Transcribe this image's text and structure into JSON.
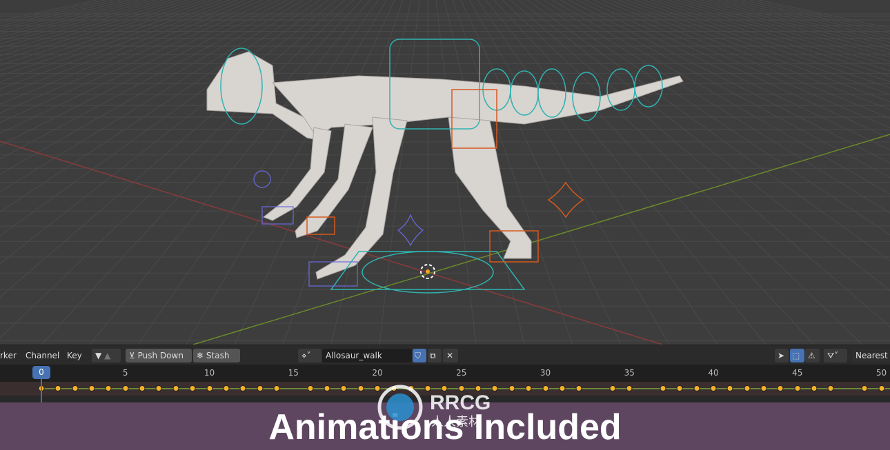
{
  "header": {
    "menus": [
      "rker",
      "Channel",
      "Key"
    ],
    "push_down": "Push Down",
    "stash": "Stash",
    "action_name": "Allosaur_walk",
    "snap_mode": "Nearest"
  },
  "timeline": {
    "current_frame": "0",
    "ruler_labels": [
      "5",
      "10",
      "15",
      "20",
      "25",
      "30",
      "35",
      "40",
      "45",
      "50"
    ],
    "keyframes": [
      0,
      1,
      2,
      3,
      4,
      5,
      6,
      7,
      8,
      9,
      10,
      11,
      12,
      13,
      14,
      16,
      17,
      18,
      19,
      20,
      21,
      22,
      23,
      24,
      25,
      26,
      27,
      28,
      29,
      30,
      31,
      32,
      34,
      35,
      37,
      38,
      39,
      40,
      41,
      42,
      43,
      44,
      45,
      46,
      47,
      49,
      50
    ]
  },
  "banner": {
    "text": "Animations Included"
  },
  "watermark": {
    "text": "RRCG",
    "subtext": "人人素材"
  },
  "colors": {
    "keyframe": "#f5b22a",
    "accent": "#4772b3",
    "banner": "#5e4660",
    "bone_cyan": "#2fb3b0",
    "bone_orange": "#d65a1f",
    "bone_blue": "#6a6ae0"
  }
}
